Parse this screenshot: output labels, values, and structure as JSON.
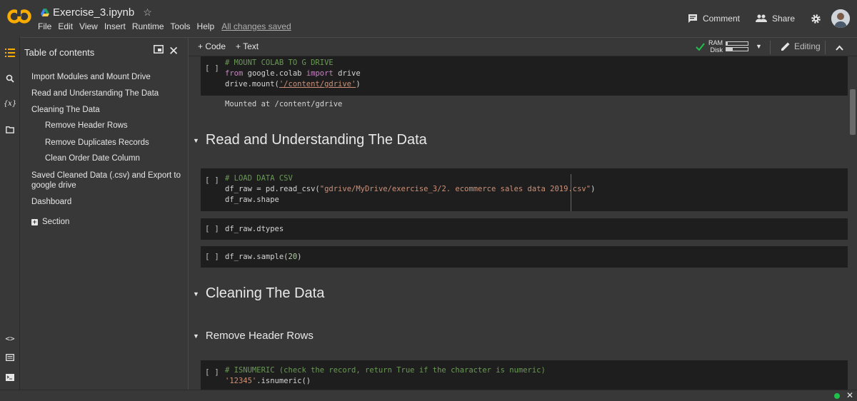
{
  "app": {
    "file_name": "Exercise_3.ipynb",
    "menu": [
      "File",
      "Edit",
      "View",
      "Insert",
      "Runtime",
      "Tools",
      "Help"
    ],
    "save_status": "All changes saved",
    "comment_label": "Comment",
    "share_label": "Share"
  },
  "toc": {
    "title": "Table of contents",
    "items": [
      "Import Modules and Mount Drive",
      "Read and Understanding The Data",
      "Cleaning The Data",
      "Remove Header Rows",
      "Remove Duplicates Records",
      "Clean Order Date Column",
      "Saved Cleaned Data (.csv) and Export to google drive",
      "Dashboard"
    ],
    "section_label": "Section"
  },
  "toolbar": {
    "add_code": "+ Code",
    "add_text": "+ Text",
    "ram_label": "RAM",
    "disk_label": "Disk",
    "ram_usage": 0.05,
    "disk_usage": 0.3,
    "editing_label": "Editing"
  },
  "cells": {
    "run_label": "[ ]",
    "mount": {
      "comment": "# MOUNT COLAB TO G DRIVE",
      "line2_kw1": "from",
      "line2_mid": " google.colab ",
      "line2_kw2": "import",
      "line2_end": " drive",
      "line3_start": "drive.mount(",
      "line3_str": "'/content/gdrive'",
      "line3_end": ")",
      "output": "Mounted at /content/gdrive"
    },
    "heading_read": "Read and Understanding The Data",
    "load": {
      "comment": "# LOAD DATA CSV",
      "line2_start": "df_raw = pd.read_csv(",
      "line2_str": "\"gdrive/MyDrive/exercise_3/2. ecommerce sales data 2019.csv\"",
      "line2_end": ")",
      "line3": "df_raw.shape"
    },
    "dtypes": "df_raw.dtypes",
    "sample_start": "df_raw.sample(",
    "sample_num": "20",
    "sample_end": ")",
    "heading_cleaning": "Cleaning The Data",
    "heading_remove": "Remove Header Rows",
    "isnumeric": {
      "comment": "# ISNUMERIC (check the record, return True if the character is numeric)",
      "line2_str": "'12345'",
      "line2_end": ".isnumeric()"
    }
  },
  "colors": {
    "background": "#383838",
    "cell_background": "#1e1e1e",
    "comment": "#6a9955",
    "keyword": "#c586c0",
    "string": "#ce9178",
    "number": "#b5cea8",
    "logo_orange": "#f9ab00",
    "status_green": "#1ec14a"
  }
}
